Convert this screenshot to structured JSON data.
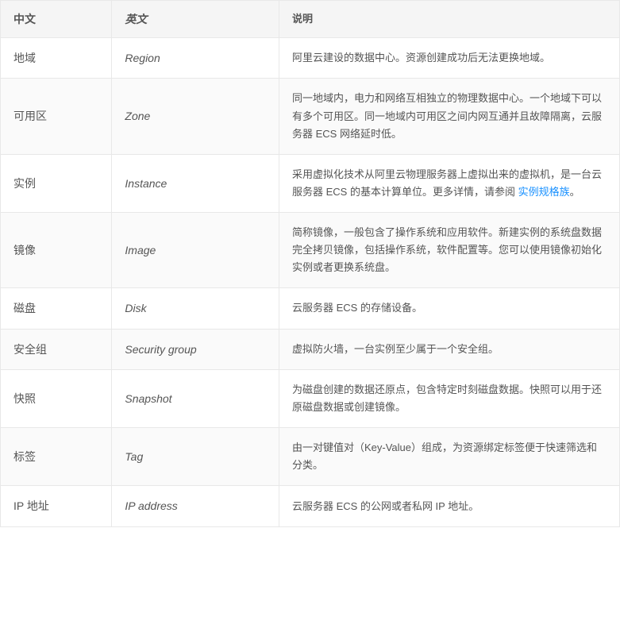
{
  "table": {
    "headers": {
      "zh": "中文",
      "en": "英文",
      "desc": "说明"
    },
    "rows": [
      {
        "zh": "地域",
        "en": "Region",
        "desc": "阿里云建设的数据中心。资源创建成功后无法更换地域。",
        "hasLink": false
      },
      {
        "zh": "可用区",
        "en": "Zone",
        "desc": "同一地域内，电力和网络互相独立的物理数据中心。一个地域下可以有多个可用区。同一地域内可用区之间内网互通并且故障隔离，云服务器 ECS 网络延时低。",
        "hasLink": false
      },
      {
        "zh": "实例",
        "en": "Instance",
        "desc_before": "采用虚拟化技术从阿里云物理服务器上虚拟出来的虚拟机，是一台云服务器 ECS 的基本计算单位。更多详情，请参阅 ",
        "desc_link_text": "实例规格族",
        "desc_after": "。",
        "hasLink": true
      },
      {
        "zh": "镜像",
        "en": "Image",
        "desc": "简称镜像，一般包含了操作系统和应用软件。新建实例的系统盘数据完全拷贝镜像，包括操作系统，软件配置等。您可以使用镜像初始化实例或者更换系统盘。",
        "hasLink": false
      },
      {
        "zh": "磁盘",
        "en": "Disk",
        "desc": "云服务器 ECS 的存储设备。",
        "hasLink": false
      },
      {
        "zh": "安全组",
        "en": "Security group",
        "desc": "虚拟防火墙，一台实例至少属于一个安全组。",
        "hasLink": false
      },
      {
        "zh": "快照",
        "en": "Snapshot",
        "desc": "为磁盘创建的数据还原点，包含特定时刻磁盘数据。快照可以用于还原磁盘数据或创建镜像。",
        "hasLink": false
      },
      {
        "zh": "标签",
        "en": "Tag",
        "desc": "由一对键值对（Key-Value）组成，为资源绑定标签便于快速筛选和分类。",
        "hasLink": false
      },
      {
        "zh": "IP 地址",
        "en": "IP address",
        "desc": "云服务器 ECS 的公网或者私网 IP 地址。",
        "hasLink": false
      }
    ]
  }
}
